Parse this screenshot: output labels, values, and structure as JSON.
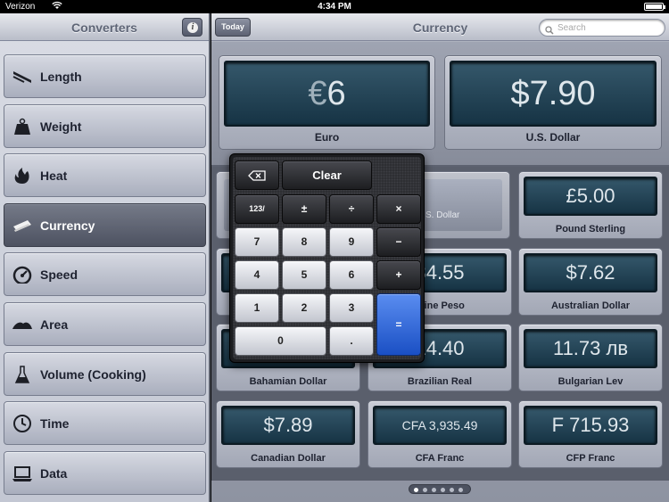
{
  "status_bar": {
    "carrier": "Verizon",
    "time": "4:34 PM"
  },
  "sidebar": {
    "title": "Converters",
    "info_icon": "info-icon",
    "items": [
      {
        "label": "Length",
        "icon": "ruler-icon",
        "active": false
      },
      {
        "label": "Weight",
        "icon": "weight-icon",
        "active": false
      },
      {
        "label": "Heat",
        "icon": "flame-icon",
        "active": false
      },
      {
        "label": "Currency",
        "icon": "banknote-icon",
        "active": true
      },
      {
        "label": "Speed",
        "icon": "speedometer-icon",
        "active": false
      },
      {
        "label": "Area",
        "icon": "area-icon",
        "active": false
      },
      {
        "label": "Volume (Cooking)",
        "icon": "beaker-icon",
        "active": false
      },
      {
        "label": "Time",
        "icon": "clock-icon",
        "active": false
      },
      {
        "label": "Data",
        "icon": "laptop-icon",
        "active": false
      }
    ]
  },
  "main": {
    "today_label": "Today",
    "title": "Currency",
    "search_placeholder": "Search",
    "source": {
      "prefix": "€",
      "value": "6",
      "name": "Euro"
    },
    "target": {
      "value": "$7.90",
      "name": "U.S. Dollar"
    },
    "grid": [
      {
        "value": "",
        "name": "",
        "partial_label": "S. Dollar"
      },
      {
        "value": "£5.00",
        "name": "Pound Sterling"
      },
      {
        "value": "",
        "name": ""
      },
      {
        "value": "34.55",
        "name": "ntine Peso"
      },
      {
        "value": "$7.62",
        "name": "Australian Dollar"
      },
      {
        "value": "",
        "name": "Bahamian Dollar"
      },
      {
        "value": "14.40",
        "name": "Brazilian Real"
      },
      {
        "value": "11.73 лв",
        "name": "Bulgarian Lev"
      },
      {
        "value": "$7.89",
        "name": "Canadian Dollar"
      },
      {
        "value": "CFA 3,935.49",
        "name": "CFA Franc"
      },
      {
        "value": "F 715.93",
        "name": "CFP Franc"
      }
    ],
    "pages": {
      "count": 6,
      "current": 1
    }
  },
  "calculator": {
    "backspace_icon": "backspace-icon",
    "keys": {
      "clear": "Clear",
      "mode": "123/",
      "plus_minus": "±",
      "divide": "÷",
      "multiply": "×",
      "seven": "7",
      "eight": "8",
      "nine": "9",
      "minus": "−",
      "four": "4",
      "five": "5",
      "six": "6",
      "plus": "+",
      "one": "1",
      "two": "2",
      "three": "3",
      "equals": "=",
      "zero": "0",
      "decimal": "."
    }
  },
  "colors": {
    "active_item": "#5f6473",
    "screen": "#1f4153",
    "equals_key": "#2f66da"
  }
}
